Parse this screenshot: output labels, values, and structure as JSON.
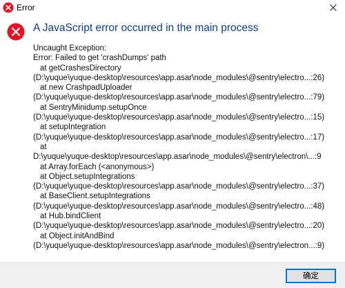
{
  "window": {
    "title": "Error",
    "close_glyph": "✕"
  },
  "dialog": {
    "icon": "error-icon",
    "accent_color": "#e81123",
    "main_instruction": "A JavaScript error occurred in the main process",
    "message_lines": [
      {
        "text": "Uncaught Exception:",
        "indent": false
      },
      {
        "text": "Error: Failed to get 'crashDumps' path",
        "indent": false
      },
      {
        "text": "at getCrashesDirectory",
        "indent": true
      },
      {
        "text": "(D:\\yuque\\yuque-desktop\\resources\\app.asar\\node_modules\\@sentry\\electro...:26)",
        "indent": false
      },
      {
        "text": "at new CrashpadUploader",
        "indent": true
      },
      {
        "text": "(D:\\yuque\\yuque-desktop\\resources\\app.asar\\node_modules\\@sentry\\electro...:79)",
        "indent": false
      },
      {
        "text": "at SentryMinidump.setupOnce",
        "indent": true
      },
      {
        "text": "(D:\\yuque\\yuque-desktop\\resources\\app.asar\\node_modules\\@sentry\\electro...:15)",
        "indent": false
      },
      {
        "text": "at setupIntegration",
        "indent": true
      },
      {
        "text": "(D:\\yuque\\yuque-desktop\\resources\\app.asar\\node_modules\\@sentry\\electro...:17)",
        "indent": false
      },
      {
        "text": "at",
        "indent": true
      },
      {
        "text": "D:\\yuque\\yuque-desktop\\resources\\app.asar\\node_modules\\@sentry\\electron\\...:9",
        "indent": false
      },
      {
        "text": "at Array.forEach (<anonymous>)",
        "indent": true
      },
      {
        "text": "at Object.setupIntegrations",
        "indent": true
      },
      {
        "text": "(D:\\yuque\\yuque-desktop\\resources\\app.asar\\node_modules\\@sentry\\electro...:37)",
        "indent": false
      },
      {
        "text": "at BaseClient.setupIntegrations",
        "indent": true
      },
      {
        "text": "(D:\\yuque\\yuque-desktop\\resources\\app.asar\\node_modules\\@sentry\\electro...:48)",
        "indent": false
      },
      {
        "text": "at Hub.bindClient",
        "indent": true
      },
      {
        "text": "(D:\\yuque\\yuque-desktop\\resources\\app.asar\\node_modules\\@sentry\\electro...:20)",
        "indent": false
      },
      {
        "text": "at Object.initAndBind",
        "indent": true
      },
      {
        "text": "(D:\\yuque\\yuque-desktop\\resources\\app.asar\\node_modules\\@sentry\\electron...:9)",
        "indent": false
      }
    ]
  },
  "footer": {
    "ok_label": "确定"
  }
}
